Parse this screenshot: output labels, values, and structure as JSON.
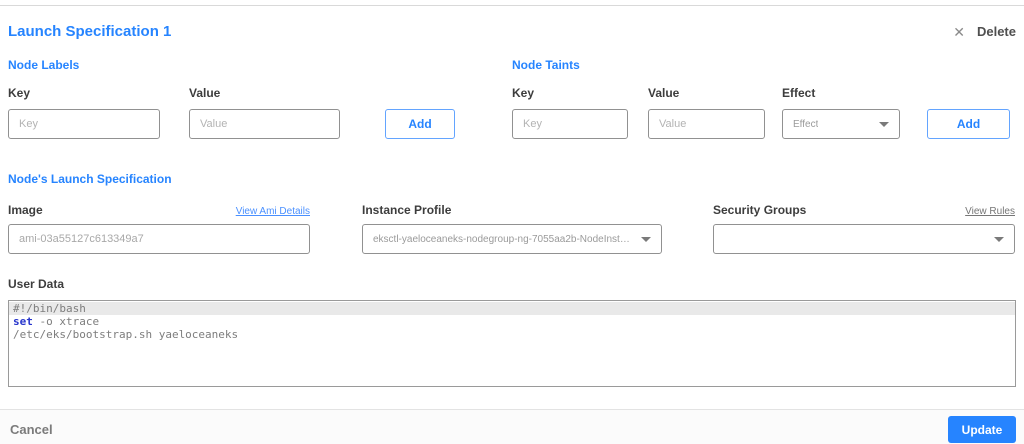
{
  "colors": {
    "accent": "#2684ff",
    "keyword_blue": "#2836cc",
    "link_gray": "#767676"
  },
  "icons": {
    "delete": "✕",
    "chevron_down": "caret-down-triangle"
  },
  "header": {
    "title": "Launch Specification 1",
    "delete_label": "Delete"
  },
  "node_labels": {
    "heading": "Node Labels",
    "key_label": "Key",
    "key_placeholder": "Key",
    "value_label": "Value",
    "value_placeholder": "Value",
    "add_label": "Add"
  },
  "node_taints": {
    "heading": "Node Taints",
    "key_label": "Key",
    "key_placeholder": "Key",
    "value_label": "Value",
    "value_placeholder": "Value",
    "effect_label": "Effect",
    "effect_placeholder": "Effect",
    "add_label": "Add"
  },
  "launch_spec": {
    "heading": "Node's Launch Specification",
    "image": {
      "label": "Image",
      "link": "View Ami Details",
      "value": "ami-03a55127c613349a7"
    },
    "instance_profile": {
      "label": "Instance Profile",
      "value": "eksctl-yaeloceaneks-nodegroup-ng-7055aa2b-NodeInstanceProfile-..."
    },
    "security_groups": {
      "label": "Security Groups",
      "link": "View Rules",
      "value": ""
    }
  },
  "user_data": {
    "label": "User Data",
    "line1": "#!/bin/bash",
    "line2_keyword": "set",
    "line2_rest": " -o xtrace",
    "line3": "/etc/eks/bootstrap.sh yaeloceaneks"
  },
  "footer": {
    "cancel_label": "Cancel",
    "update_label": "Update"
  }
}
